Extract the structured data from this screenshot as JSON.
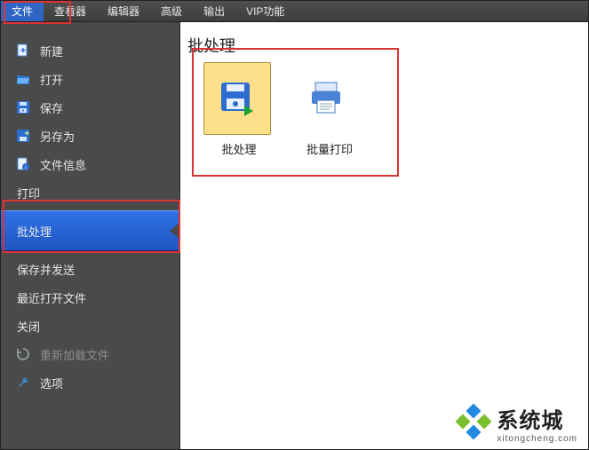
{
  "menubar": {
    "items": [
      {
        "label": "文件",
        "name": "menu-file",
        "active": true
      },
      {
        "label": "查看器",
        "name": "menu-viewer",
        "active": false
      },
      {
        "label": "编辑器",
        "name": "menu-editor",
        "active": false
      },
      {
        "label": "高级",
        "name": "menu-advanced",
        "active": false
      },
      {
        "label": "输出",
        "name": "menu-output",
        "active": false
      },
      {
        "label": "VIP功能",
        "name": "menu-vip",
        "active": false
      }
    ]
  },
  "sidebar": {
    "items": [
      {
        "label": "新建",
        "name": "side-new",
        "icon": "file-plus-icon"
      },
      {
        "label": "打开",
        "name": "side-open",
        "icon": "folder-open-icon"
      },
      {
        "label": "保存",
        "name": "side-save",
        "icon": "save-icon"
      },
      {
        "label": "另存为",
        "name": "side-saveas",
        "icon": "saveas-icon"
      },
      {
        "label": "文件信息",
        "name": "side-fileinfo",
        "icon": "info-icon"
      },
      {
        "label": "打印",
        "name": "side-print",
        "icon": "",
        "noicon": true
      },
      {
        "label": "批处理",
        "name": "side-batch",
        "icon": "",
        "selected": true,
        "noicon": true
      },
      {
        "label": "保存并发送",
        "name": "side-savesend",
        "icon": "",
        "noicon": true
      },
      {
        "label": "最近打开文件",
        "name": "side-recent",
        "icon": "",
        "noicon": true
      },
      {
        "label": "关闭",
        "name": "side-close",
        "icon": "",
        "noicon": true
      },
      {
        "label": "重新加载文件",
        "name": "side-reload",
        "icon": "reload-icon",
        "disabled": true
      },
      {
        "label": "选项",
        "name": "side-options",
        "icon": "wrench-icon"
      }
    ]
  },
  "main": {
    "title": "批处理",
    "tiles": [
      {
        "label": "批处理",
        "name": "tile-batch",
        "icon": "batch-save-icon",
        "selected": true
      },
      {
        "label": "批量打印",
        "name": "tile-batchprint",
        "icon": "batch-print-icon"
      }
    ]
  },
  "watermark": {
    "title": "系统城",
    "url": "xitongcheng.com"
  },
  "colors": {
    "accent": "#2f73e6",
    "annot": "#d33b33",
    "tile_selected_bg": "#ffe08a"
  }
}
